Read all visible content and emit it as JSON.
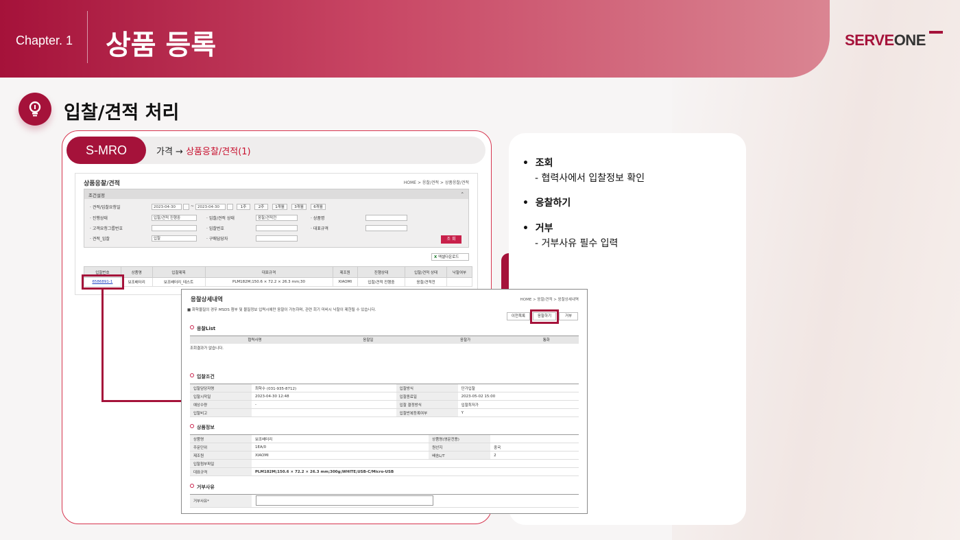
{
  "header": {
    "chapter": "Chapter. 1",
    "title": "상품 등록",
    "logo_red": "SERVE",
    "logo_dark": "ONE"
  },
  "section": {
    "title": "입찰/견적 처리"
  },
  "nav": {
    "badge": "S-MRO",
    "path_prefix": "가격 → ",
    "path_current": "상품응찰/견적(1)"
  },
  "notes": [
    {
      "title": "조회",
      "desc": "- 협력사에서 입찰정보 확인"
    },
    {
      "title": "응찰하기",
      "desc": ""
    },
    {
      "title": "거부",
      "desc": "- 거부사유 필수 입력"
    }
  ],
  "screen1": {
    "title": "상품응찰/견적",
    "breadcrumb": "HOME > 응찰/견적 > 상품응찰/견적",
    "cond_title": "조건설정",
    "labels": {
      "period": "· 견적/입찰요청일",
      "status": "· 진행상태",
      "bid_status": "· 입찰/견적 상태",
      "product": "· 상품명",
      "group": "· 고객요청그룹번호",
      "bid_no": "· 입찰번호",
      "spec": "· 대표규격",
      "type": "· 견적_입찰",
      "buyer": "· 구매담당자"
    },
    "date_from": "2023-04-30",
    "date_to": "2023-04-30",
    "periods": [
      "1주",
      "2주",
      "1개월",
      "3개월",
      "6개월"
    ],
    "status_value": "입찰/견적 진행중",
    "bid_status_value": "응찰/견적전",
    "type_value": "입찰",
    "search_button": "조 회",
    "excel_button": "엑셀다운로드",
    "columns": [
      "입찰번호",
      "상품명",
      "입찰제목",
      "대표규격",
      "제조원",
      "진행상태",
      "입찰/견적 상태",
      "낙찰여부"
    ],
    "row": [
      "6586891-1",
      "보조배터리",
      "보조배터리_테스트",
      "PLM182M;150.6 × 72.2 × 26.3 mm;30",
      "XIAOMI",
      "입찰/견적 진행중",
      "응찰/견적전",
      ""
    ]
  },
  "screen2": {
    "title": "응찰상세내역",
    "breadcrumb": "HOME > 응찰/견적 > 응찰상세내역",
    "note": "■ 화학물질의 경우 MSDS 첨부 및 물질정보 입력시에만 응찰이 가능하며, 관련 회기 미비시 낙찰이 제한될 수 있습니다.",
    "buttons": {
      "prev": "이전목록",
      "bid": "응찰하기",
      "reject": "거부"
    },
    "bid_list_title": "응찰List",
    "bid_list_columns": [
      "협력사명",
      "응찰일",
      "응찰가",
      "통화"
    ],
    "empty": "조회결과가 없습니다.",
    "cond_title": "입찰조건",
    "cond_rows": [
      [
        "입찰담당자명",
        "최학수 (031-935-8712)",
        "입찰방식",
        "단가입찰"
      ],
      [
        "입찰시작일",
        "2023-04-30 12:48",
        "입찰종료일",
        "2023-05-02 15:00"
      ],
      [
        "예상수량",
        "-",
        "입찰 결정방식",
        "입찰최저가"
      ],
      [
        "입찰비고",
        "",
        "입찰반복등록여부",
        "Y"
      ]
    ],
    "prod_title": "상품정보",
    "prod_rows": [
      [
        "상품명",
        "보조배터리",
        "상품명(영문전용)",
        ""
      ],
      [
        "주문단위",
        "1EA/0",
        "원산지",
        "중국"
      ],
      [
        "제조원",
        "XIAOMI",
        "배송L/T",
        "2"
      ]
    ],
    "attach_label": "입찰첨부파일",
    "spec_label": "대표규격",
    "spec_value": "PLM182M;150.6 × 72.2 × 26.3 mm;300g;WHITE;USB-C/Micro-USB",
    "reject_title": "거부사유",
    "reject_label": "거부사유*"
  }
}
